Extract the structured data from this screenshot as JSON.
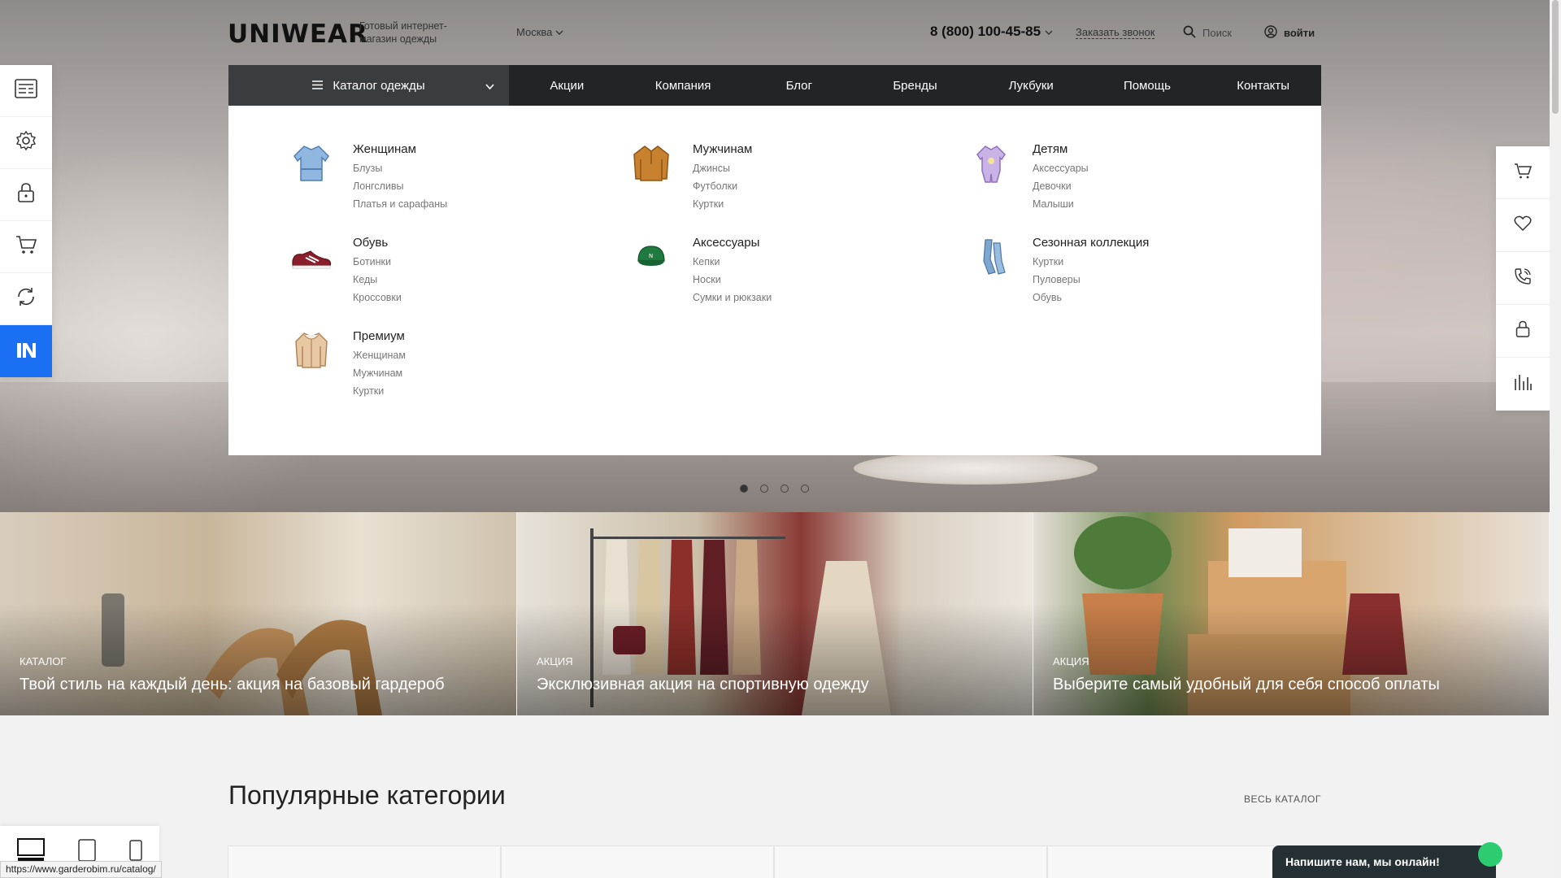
{
  "header": {
    "logo": "UNIWEAR",
    "tagline": "Готовый интернет-магазин одежды",
    "city": "Москва",
    "phone": "8 (800) 100-45-85",
    "callback": "Заказать звонок",
    "search": "Поиск",
    "login": "войти"
  },
  "nav": {
    "catalog": "Каталог одежды",
    "items": [
      "Акции",
      "Компания",
      "Блог",
      "Бренды",
      "Лукбуки",
      "Помощь",
      "Контакты"
    ]
  },
  "dropdown": {
    "categories": [
      {
        "title": "Женщинам",
        "icon": "blouse-icon",
        "subs": [
          "Блузы",
          "Лонгсливы",
          "Платья и сарафаны"
        ]
      },
      {
        "title": "Мужчинам",
        "icon": "sweater-icon",
        "subs": [
          "Джинсы",
          "Футболки",
          "Куртки"
        ]
      },
      {
        "title": "Детям",
        "icon": "baby-romper-icon",
        "subs": [
          "Аксессуары",
          "Девочки",
          "Малыши"
        ]
      },
      {
        "title": "Обувь",
        "icon": "sneaker-icon",
        "subs": [
          "Ботинки",
          "Кеды",
          "Кроссовки"
        ]
      },
      {
        "title": "Аксессуары",
        "icon": "cap-icon",
        "subs": [
          "Кепки",
          "Носки",
          "Сумки и рюкзаки"
        ]
      },
      {
        "title": "Сезонная коллекция",
        "icon": "scarf-icon",
        "subs": [
          "Куртки",
          "Пуловеры",
          "Обувь"
        ]
      },
      {
        "title": "Премиум",
        "icon": "jacket-icon",
        "subs": [
          "Женщинам",
          "Мужчинам",
          "Куртки"
        ]
      }
    ]
  },
  "promos": [
    {
      "tag": "КАТАЛОГ",
      "title": "Твой стиль на каждый день: акция на базовый гардероб"
    },
    {
      "tag": "АКЦИЯ",
      "title": "Эксклюзивная акция на спортивную одежду"
    },
    {
      "tag": "АКЦИЯ",
      "title": "Выберите самый удобный для себя способ оплаты"
    }
  ],
  "popular": {
    "title": "Популярные категории",
    "all_link": "ВЕСЬ КАТАЛОГ"
  },
  "chat": {
    "label": "Напишите нам, мы онлайн!"
  },
  "status_url": "https://www.garderobim.ru/catalog/",
  "slider": {
    "total": 4,
    "active": 1
  },
  "colors": {
    "accent": "#1a6ff2",
    "nav_bg": "#222426",
    "catalog_bg": "#3a3d40",
    "chat_bg": "#253034"
  }
}
